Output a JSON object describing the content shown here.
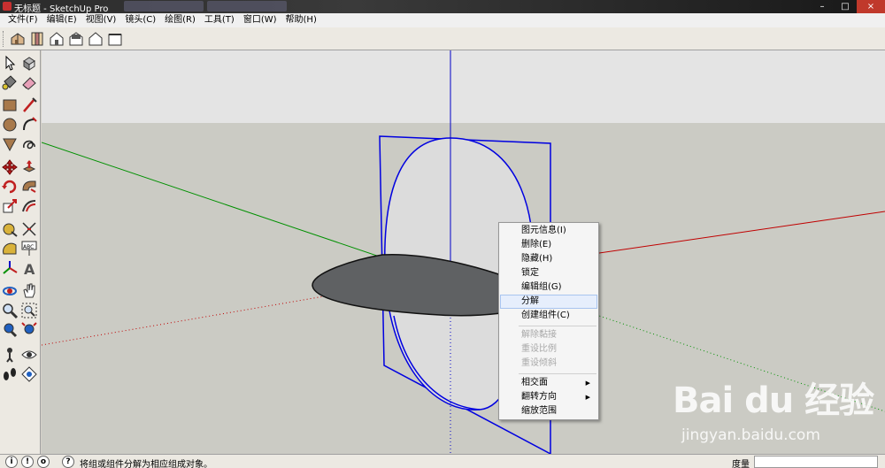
{
  "window": {
    "title": "无标题 - SketchUp Pro"
  },
  "menubar": {
    "items": [
      "文件(F)",
      "编辑(E)",
      "视图(V)",
      "镜头(C)",
      "绘图(R)",
      "工具(T)",
      "窗口(W)",
      "帮助(H)"
    ]
  },
  "toolbar": {
    "views": [
      "iso-view-icon",
      "top-view-icon",
      "front-view-icon",
      "right-view-icon",
      "back-view-icon",
      "left-view-icon"
    ]
  },
  "tools": [
    "select-icon",
    "make-component-icon",
    "paint-bucket-icon",
    "eraser-icon",
    "rectangle-icon",
    "line-icon",
    "circle-icon",
    "arc-icon",
    "polygon-icon",
    "freehand-icon",
    "move-icon",
    "push-pull-icon",
    "rotate-icon",
    "follow-me-icon",
    "scale-icon",
    "offset-icon",
    "tape-measure-icon",
    "dimension-icon",
    "protractor-icon",
    "text-icon",
    "axes-icon",
    "3d-text-icon",
    "orbit-icon",
    "pan-icon",
    "zoom-icon",
    "zoom-window-icon",
    "previous-view-icon",
    "zoom-extents-icon",
    "position-camera-icon",
    "look-around-icon",
    "walk-icon",
    "section-plane-icon"
  ],
  "context_menu": {
    "items": [
      {
        "label": "图元信息(I)",
        "state": "normal"
      },
      {
        "label": "删除(E)",
        "state": "normal"
      },
      {
        "label": "隐藏(H)",
        "state": "normal"
      },
      {
        "label": "锁定",
        "state": "normal"
      },
      {
        "label": "编辑组(G)",
        "state": "normal"
      },
      {
        "label": "分解",
        "state": "highlighted"
      },
      {
        "label": "创建组件(C)",
        "state": "normal"
      },
      {
        "label": "解除黏接",
        "state": "disabled"
      },
      {
        "label": "重设比例",
        "state": "disabled"
      },
      {
        "label": "重设倾斜",
        "state": "disabled"
      },
      {
        "label": "相交面",
        "state": "submenu"
      },
      {
        "label": "翻转方向",
        "state": "submenu"
      },
      {
        "label": "缩放范围",
        "state": "normal"
      }
    ]
  },
  "statusbar": {
    "message": "将组或组件分解为相应组成对象。",
    "measure_label": "度量",
    "measure_value": ""
  },
  "watermark": {
    "brand": "Bai du 经验",
    "url": "jingyan.baidu.com"
  },
  "colors": {
    "sky": "#e4e4e4",
    "ground": "#cbcbc4",
    "axis_red": "#c00000",
    "axis_green": "#009000",
    "axis_blue": "#0000c8",
    "selection": "#0000e0",
    "ellipse_fill": "#5f6163",
    "accent_highlight": "#e6eefc"
  }
}
